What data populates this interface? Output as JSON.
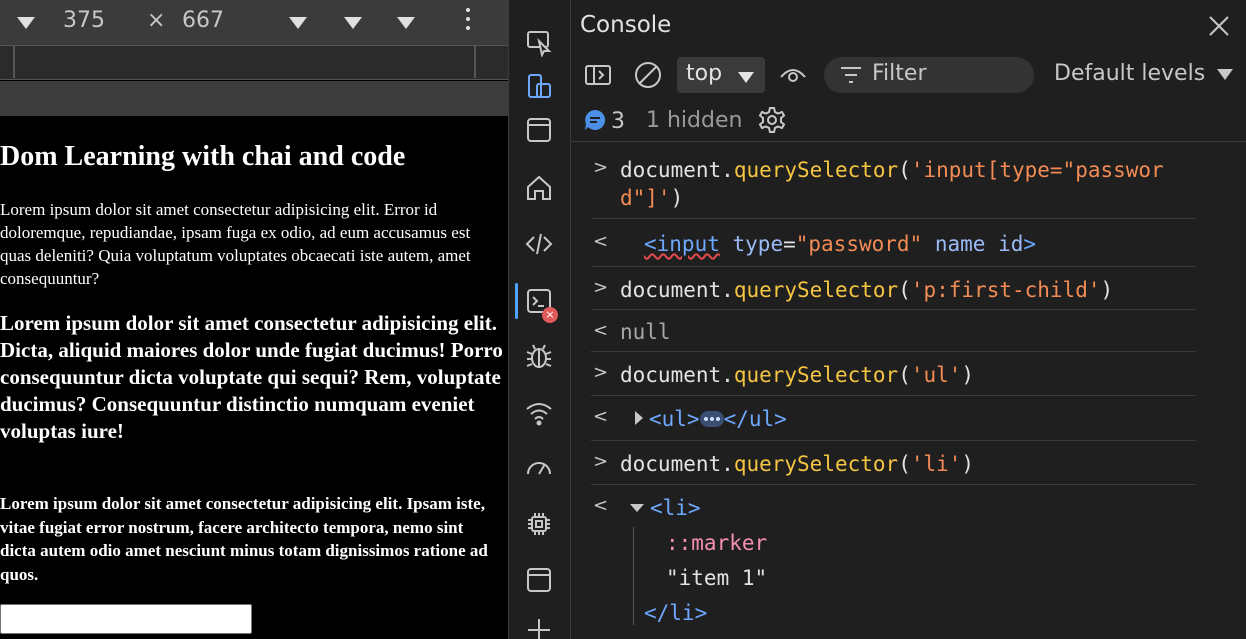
{
  "device_toolbar": {
    "width": "375",
    "times": "×",
    "height": "667"
  },
  "page": {
    "heading": "Dom Learning with chai and code",
    "para1": "Lorem ipsum dolor sit amet consectetur adipisicing elit. Error id doloremque, repudiandae, ipsam fuga ex odio, ad eum accusamus est quas deleniti? Quia voluptatum voluptates obcaecati iste autem, amet consequuntur?",
    "para2": "Lorem ipsum dolor sit amet consectetur adipisicing elit. Dicta, aliquid maiores dolor unde fugiat ducimus! Porro consequuntur dicta voluptate qui sequi? Rem, voluptate ducimus? Consequuntur distinctio numquam eveniet voluptas iure!",
    "para3": "Lorem ipsum dolor sit amet consectetur adipisicing elit. Ipsam iste, vitae fugiat error nostrum, facere architecto tempora, nemo sint dicta autem odio amet nesciunt minus totam dignissimos ratione ad quos."
  },
  "activity_bar": {
    "icons": [
      "inspect-icon",
      "device-toggle-icon",
      "elements-panel-icon",
      "welcome-home-icon",
      "sources-code-icon",
      "console-icon",
      "issues-bug-icon",
      "network-wifi-icon",
      "performance-gauge-icon",
      "memory-chip-icon",
      "application-icon",
      "add-tool-icon"
    ],
    "selected": "console-icon"
  },
  "console": {
    "title": "Console",
    "context": "top",
    "filter_placeholder": "Filter",
    "levels": "Default levels",
    "message_count": "3",
    "hidden": "1 hidden",
    "entries": [
      {
        "kind": "input",
        "obj": "document",
        "dot": ".",
        "method": "querySelector",
        "open": "(",
        "arg1": "'input[type=\"passwor",
        "arg2": "d\"]'",
        "close": ")"
      },
      {
        "kind": "output",
        "tag_open": "<input",
        "attr1": "type",
        "eq": "=",
        "val1": "\"password\"",
        "attr2": "name",
        "attr3": "id",
        "tag_close": ">"
      },
      {
        "kind": "input",
        "obj": "document",
        "dot": ".",
        "method": "querySelector",
        "open": "(",
        "arg": "'p:first-child'",
        "close": ")"
      },
      {
        "kind": "output",
        "value": "null"
      },
      {
        "kind": "input",
        "obj": "document",
        "dot": ".",
        "method": "querySelector",
        "open": "(",
        "arg": "'ul'",
        "close": ")"
      },
      {
        "kind": "output",
        "open_tag": "<ul>",
        "close_tag": "</ul>"
      },
      {
        "kind": "input",
        "obj": "document",
        "dot": ".",
        "method": "querySelector",
        "open": "(",
        "arg": "'li'",
        "close": ")"
      },
      {
        "kind": "output",
        "open_tag": "<li>",
        "marker": "::marker",
        "text": "\"item 1\"",
        "close_tag": "</li>"
      }
    ]
  },
  "colors": {
    "method": "#f5c542",
    "string": "#f28b54",
    "tag": "#6ea8fe",
    "marker": "#f48fb1",
    "selection": "#4da3ff"
  }
}
